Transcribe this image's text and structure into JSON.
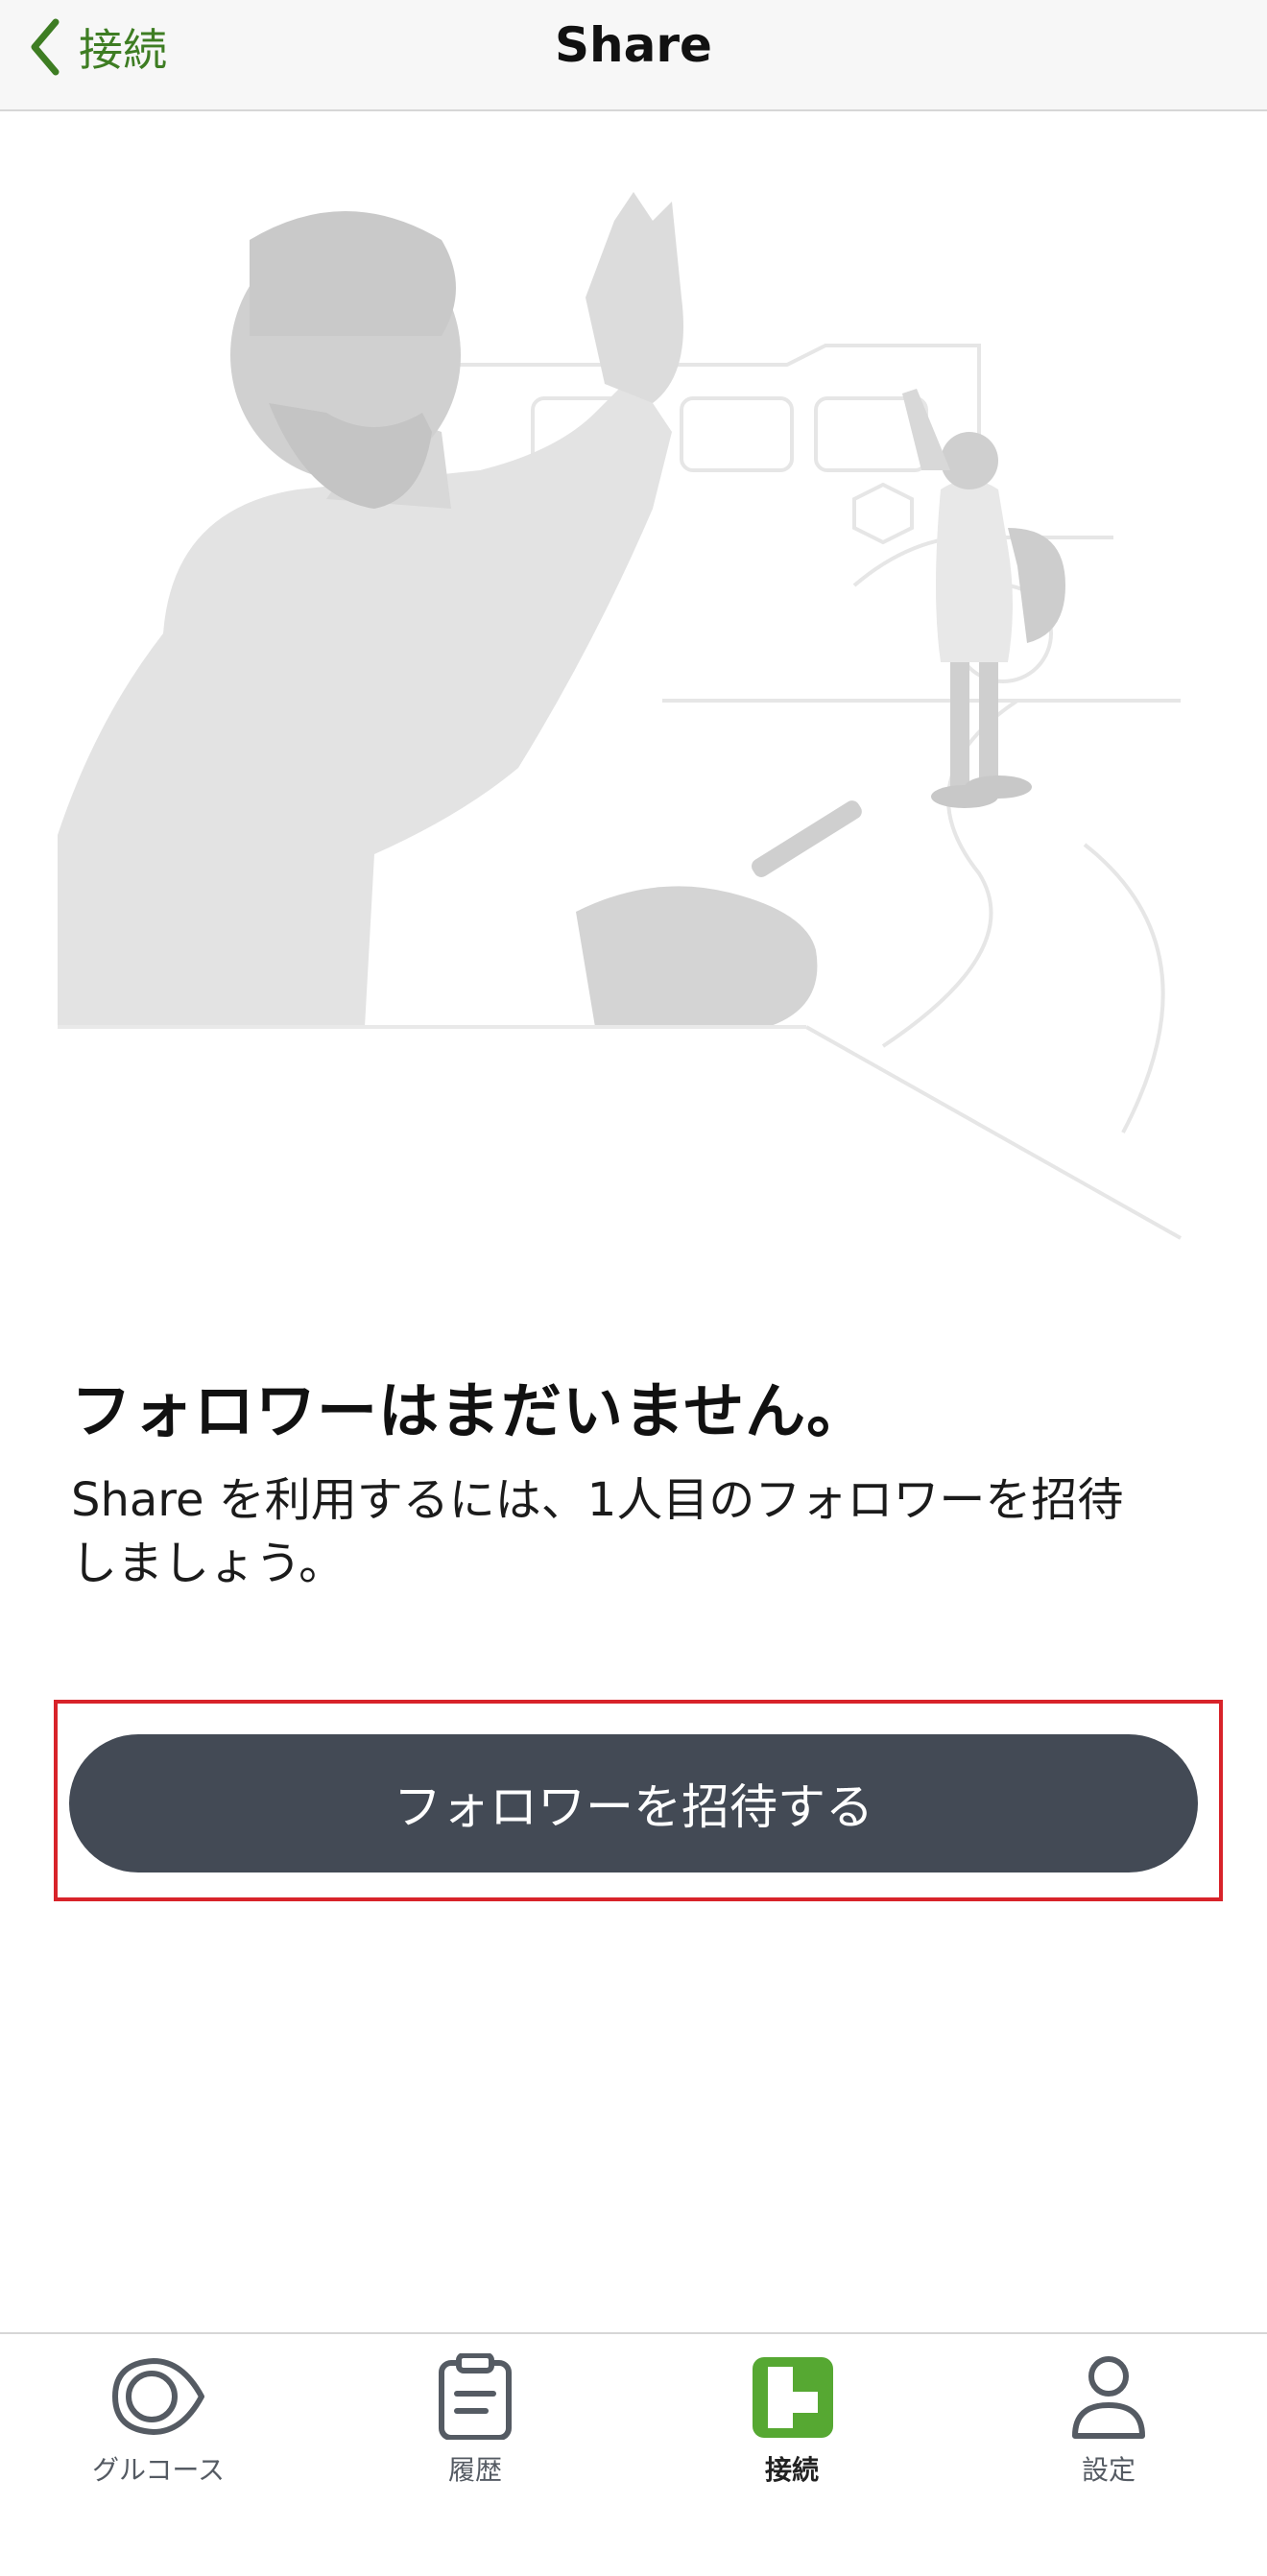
{
  "nav": {
    "back_label": "接続",
    "title": "Share"
  },
  "empty_state": {
    "title": "フォロワーはまだいません。",
    "description_line1": "Share を利用するには、1人目のフォロワーを招待",
    "description_line2": "しましょう。"
  },
  "invite_button": {
    "label": "フォロワーを招待する"
  },
  "tabs": [
    {
      "label": "グルコース",
      "icon": "glucose-drop-icon",
      "active": false
    },
    {
      "label": "履歴",
      "icon": "clipboard-icon",
      "active": false
    },
    {
      "label": "接続",
      "icon": "connections-icon",
      "active": true
    },
    {
      "label": "設定",
      "icon": "person-icon",
      "active": false
    }
  ],
  "colors": {
    "accent_green": "#3e7d23",
    "active_tab_green": "#56a832",
    "button_dark": "#434a55",
    "highlight_red": "#d8232a",
    "illustration_gray": "#e5e5e5"
  }
}
